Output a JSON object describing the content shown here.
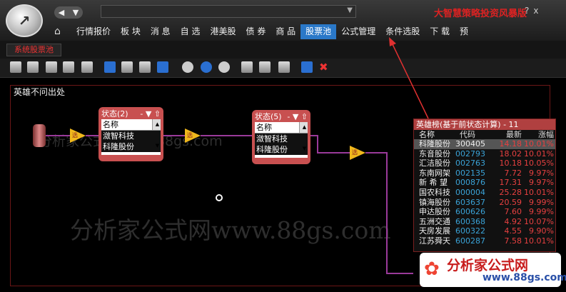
{
  "header": {
    "back_icon": "◀",
    "dropdown_icon": "▼",
    "brand": "大智慧策略投资风暴版",
    "window_buttons": [
      "?",
      "x"
    ]
  },
  "menu": {
    "items": [
      "行情报价",
      "板 块",
      "消 息",
      "自 选",
      "港美股",
      "债 券",
      "商 品",
      "股票池",
      "公式管理",
      "条件选股",
      "下 载",
      "预"
    ],
    "active_index": 7
  },
  "subtab": {
    "label": "系统股票池"
  },
  "canvas": {
    "title": "英雄不问出处",
    "watermark_small": "分析家公式网www.88gs.com",
    "watermark_big": "分析家公式网www.88gs.com"
  },
  "nodes": {
    "trigger_label": "选",
    "state1": {
      "title": "状态(2)",
      "header": "名称",
      "items": [
        "潋智科技",
        "科隆股份"
      ]
    },
    "state2": {
      "title": "状态(5)",
      "header": "名称",
      "items": [
        "潋智科技",
        "科隆股份"
      ]
    },
    "title_buttons": "- ▼ ⇧"
  },
  "result_table": {
    "title": "英雄榜(基于前状态计算) - 11",
    "columns": [
      "名称",
      "代码",
      "最新",
      "涨幅"
    ],
    "rows": [
      {
        "name": "科隆股份",
        "code": "300405",
        "price": "14.18",
        "chg": "10.01%"
      },
      {
        "name": "东音股份",
        "code": "002793",
        "price": "18.02",
        "chg": "10.01%"
      },
      {
        "name": "汇洁股份",
        "code": "002763",
        "price": "10.18",
        "chg": "10.05%"
      },
      {
        "name": "东南网架",
        "code": "002135",
        "price": "7.72",
        "chg": "9.97%"
      },
      {
        "name": "新 希 望",
        "code": "000876",
        "price": "17.31",
        "chg": "9.97%"
      },
      {
        "name": "国农科技",
        "code": "000004",
        "price": "25.28",
        "chg": "10.01%"
      },
      {
        "name": "镇海股份",
        "code": "603637",
        "price": "20.59",
        "chg": "9.99%"
      },
      {
        "name": "申达股份",
        "code": "600626",
        "price": "7.60",
        "chg": "9.99%"
      },
      {
        "name": "五洲交通",
        "code": "600368",
        "price": "4.92",
        "chg": "10.07%"
      },
      {
        "name": "天房发展",
        "code": "600322",
        "price": "4.55",
        "chg": "9.90%"
      },
      {
        "name": "江苏舜天",
        "code": "600287",
        "price": "7.58",
        "chg": "10.01%"
      }
    ]
  },
  "footer_logo": {
    "text": "分析家公式网",
    "url": "www.88gs.com"
  },
  "colors": {
    "accent": "#2a78c8",
    "panel": "#c85050",
    "brand_red": "#d22222",
    "up": "#e84040",
    "code": "#3aa3d8"
  }
}
